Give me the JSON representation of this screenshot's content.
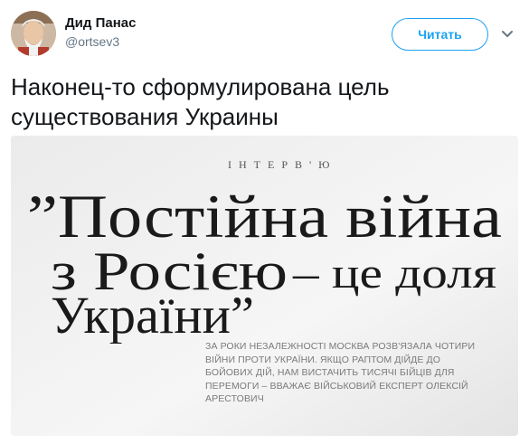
{
  "user": {
    "name": "Дид Панас",
    "handle": "@ortsev3"
  },
  "actions": {
    "follow_label": "Читать",
    "more_icon": "chevron-down-icon"
  },
  "tweet": {
    "text": "Наконец-то сформулирована цель существования Украины"
  },
  "photo": {
    "kicker": "ІНТЕРВ'Ю",
    "headline": {
      "line1": "”Постійна війна",
      "line2a": "з Росією",
      "line2b": "– це доля",
      "line3": "України”"
    },
    "lead": "За роки незалежності Москва розв'язала чотири війни проти України. Якщо раптом дійде до бойових дій, нам вистачить тисячі бійців для перемоги – вважає військовий експерт Олексій Арестович"
  },
  "colors": {
    "accent": "#1da1f2",
    "text": "#14171a",
    "secondary": "#657786"
  }
}
